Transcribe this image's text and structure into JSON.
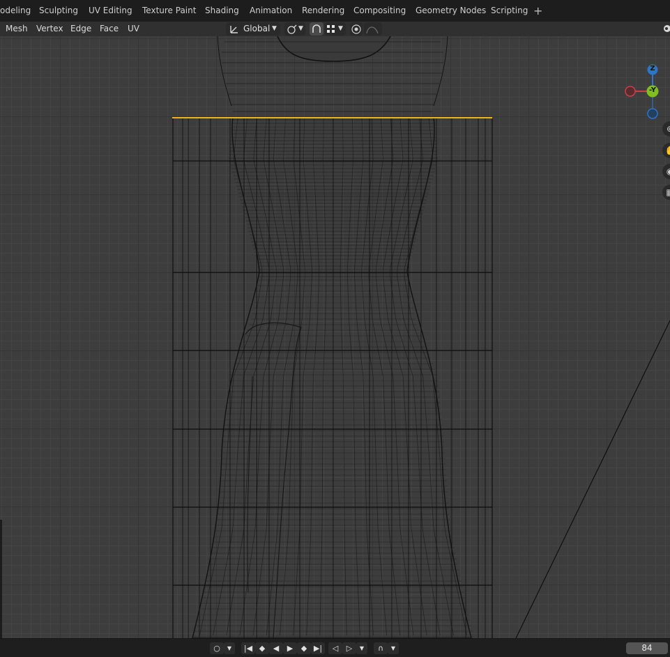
{
  "workspace_tabs": [
    {
      "label": "odeling"
    },
    {
      "label": "Sculpting"
    },
    {
      "label": "UV Editing"
    },
    {
      "label": "Texture Paint"
    },
    {
      "label": "Shading"
    },
    {
      "label": "Animation"
    },
    {
      "label": "Rendering"
    },
    {
      "label": "Compositing"
    },
    {
      "label": "Geometry Nodes"
    },
    {
      "label": "Scripting"
    }
  ],
  "add_workspace_label": "+",
  "header_menu": {
    "mesh": "Mesh",
    "vertex": "Vertex",
    "edge": "Edge",
    "face": "Face",
    "uv": "UV"
  },
  "transform_orientation": "Global",
  "gizmo": {
    "z": "Z",
    "y": "-Y",
    "x_color": "#c8414b",
    "y_color": "#7fbf21",
    "z_color": "#2e74c9"
  },
  "colors": {
    "selection_edge": "#f2b21a",
    "wire": "#141414"
  },
  "playback": {
    "current_frame": "84"
  },
  "icons": [
    "transform-orientation-icon",
    "pivot-icon",
    "snap-icon",
    "snap-increment-icon",
    "proportional-edit-icon",
    "falloff-icon",
    "zoom-icon",
    "pan-icon",
    "camera-view-icon",
    "ortho-grid-icon",
    "record-icon",
    "jump-start-icon",
    "prev-keyframe-icon",
    "play-reverse-icon",
    "play-icon",
    "next-keyframe-icon",
    "jump-end-icon",
    "prev-marker-icon",
    "next-marker-icon",
    "auto-key-icon"
  ]
}
